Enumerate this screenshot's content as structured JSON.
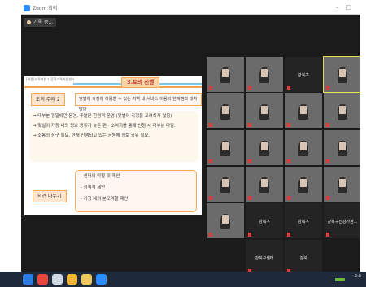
{
  "window": {
    "title": "Zoom 회의",
    "chip": "기록 중...",
    "min_glyph": "–",
    "max_glyph": "□"
  },
  "share": {
    "small_caption": "[세종]교육자원 다음학가족지원센터",
    "heading": "3.토의 진행",
    "topic_label": "토의 주제 2",
    "topic_text": "맞벌이 가정이 이용할 수 있는 지역 내 서비스 이용의 한계점과 대처방안",
    "bullets": [
      "→ 대부분 평일에만 운영, 주말은 한정적 운영 (맞벌이 가정을 고려하지 않음)",
      "→ 맞벌이 가정 내의 정보 공유가 늦은 편 · 소식지를 통해 신청 시 대부분 마감.",
      "→ 소통의 창구 필요, 현재 진행되고 있는 공동체 정보 공유 필요."
    ],
    "opinion_label": "의견 나누기",
    "opinion_items": [
      "- 센터의 탁할 및 제안",
      "- 정책적 제안",
      "- 가정 내의 분모역할 제안"
    ]
  },
  "participants": [
    {
      "label": "",
      "video": true
    },
    {
      "label": "",
      "video": true
    },
    {
      "label": "강북구",
      "video": false
    },
    {
      "label": "",
      "video": true,
      "active": true
    },
    {
      "label": "",
      "video": true
    },
    {
      "label": "",
      "video": true
    },
    {
      "label": "",
      "video": true
    },
    {
      "label": "",
      "video": true
    },
    {
      "label": "",
      "video": true
    },
    {
      "label": "",
      "video": true
    },
    {
      "label": "",
      "video": true
    },
    {
      "label": "",
      "video": true
    },
    {
      "label": "",
      "video": true
    },
    {
      "label": "",
      "video": true
    },
    {
      "label": "",
      "video": true
    },
    {
      "label": "",
      "video": true
    },
    {
      "label": "",
      "video": true
    },
    {
      "label": "강북구",
      "video": false
    },
    {
      "label": "강북구",
      "video": false
    },
    {
      "label": "강북구진강가정...",
      "video": false
    },
    {
      "label": "강북구센터",
      "video": false
    },
    {
      "label": "강북",
      "video": false
    }
  ],
  "taskbar": {
    "icons": [
      {
        "name": "start-icon",
        "color": "#2d7be0"
      },
      {
        "name": "chrome-icon",
        "color": "#e8453c"
      },
      {
        "name": "search-icon",
        "color": "#cfd8e3"
      },
      {
        "name": "app-icon",
        "color": "#f2b233"
      },
      {
        "name": "files-icon",
        "color": "#f0c75e"
      },
      {
        "name": "zoom-icon",
        "color": "#2d8cff"
      }
    ],
    "clock": "2:3"
  }
}
